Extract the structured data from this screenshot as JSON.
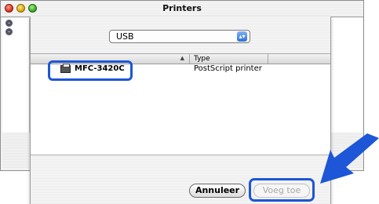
{
  "window": {
    "title": "Printers"
  },
  "connection_popup": {
    "selected": "USB"
  },
  "printer_list": {
    "columns": {
      "type": "Type"
    },
    "rows": [
      {
        "name": "MFC-3420C",
        "type": "PostScript printer"
      }
    ]
  },
  "buttons": {
    "cancel": "Annuleer",
    "add": "Voeg toe"
  },
  "colors": {
    "highlight": "#1d56d6",
    "pointer": "#1d56d6"
  },
  "icons": {
    "printer": "printer-icon",
    "pointer": "pointer-arrow-icon"
  }
}
